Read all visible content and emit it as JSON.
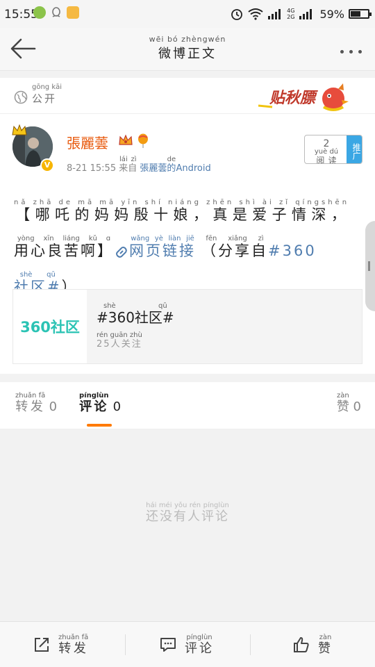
{
  "status_bar": {
    "time": "15:55",
    "network": "4G",
    "network2": "2G",
    "battery": "59%",
    "battery_level": 0.59
  },
  "header": {
    "title": "微博正文",
    "title_pinyin": "wēi bó zhèngwén"
  },
  "visibility": {
    "label": "公开",
    "pinyin": "gōng kāi",
    "sticker_text": "贴秋膘"
  },
  "post": {
    "user": "張麗蕓",
    "time": "8-21 15:55",
    "from_label": "来自",
    "from_pinyin": "lái zì",
    "source_user": "張麗蕓",
    "source_de": "的",
    "source_de_pinyin": "de",
    "source_app": "Android",
    "promo_count": "2",
    "promo_label": "阅读",
    "promo_pinyin": "yuè dú",
    "promo_side": "推广",
    "line1": "【哪吒的妈妈殷十娘，真是爱子情深，",
    "line1_pinyin": "nǎ zhā de mā mā yīn shí niáng   zhēn shì ài zǐ qíngshēn",
    "line2a": "用心良苦啊】",
    "line2a_pinyin": "yòng xīn liáng kǔ ɑ",
    "line2_link": "网页链接",
    "line2_link_pinyin": "wǎng yè liàn jiē",
    "line2b": "（分享自",
    "line2b_pinyin": "fēn xiǎng zì",
    "line2_tag": "#360",
    "line3_tag": "社区#",
    "line3_tag_pinyin": "shè qū",
    "line3_close": "）"
  },
  "share_card": {
    "logo": "360社区",
    "title": "#360社区#",
    "title_pinyin": "shè qū",
    "subtitle": "25人关注",
    "subtitle_pinyin": "rén guān zhù"
  },
  "tabs": [
    {
      "label": "转发",
      "pinyin": "zhuǎn fā",
      "count": "0"
    },
    {
      "label": "评论",
      "pinyin": "pínglùn",
      "count": "0"
    },
    {
      "label": "赞",
      "pinyin": "zàn",
      "count": "0"
    }
  ],
  "empty": {
    "text": "还没有人评论",
    "pinyin": "hái méi yǒu rén pínglùn"
  },
  "bottom_bar": [
    {
      "label": "转发",
      "pinyin": "zhuǎn fā",
      "icon": "share-icon"
    },
    {
      "label": "评论",
      "pinyin": "pínglùn",
      "icon": "comment-icon"
    },
    {
      "label": "赞",
      "pinyin": "zàn",
      "icon": "like-icon"
    }
  ],
  "colors": {
    "accent": "#ff7a00",
    "link": "#507daf",
    "username": "#e8590c",
    "promo": "#3ba7e4"
  }
}
